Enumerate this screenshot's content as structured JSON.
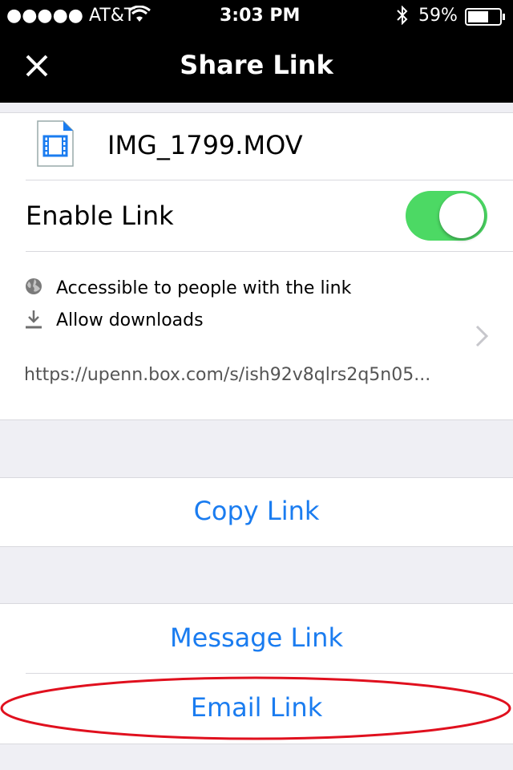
{
  "status_bar": {
    "carrier": "●●●●● AT&T",
    "time": "3:03 PM",
    "battery": "59%"
  },
  "header": {
    "title": "Share Link"
  },
  "file": {
    "name": "IMG_1799.MOV",
    "icon": "video-file-icon"
  },
  "enable_link": {
    "label": "Enable Link",
    "on": true
  },
  "settings": {
    "access": "Accessible to people with the link",
    "downloads": "Allow downloads",
    "url": "https://upenn.box.com/s/ish92v8qlrs2q5n05..."
  },
  "actions": {
    "copy": "Copy Link",
    "message": "Message Link",
    "email": "Email Link"
  },
  "colors": {
    "accent": "#1a7cf0",
    "toggle_on": "#4cd964",
    "annotation": "#e0101e"
  }
}
